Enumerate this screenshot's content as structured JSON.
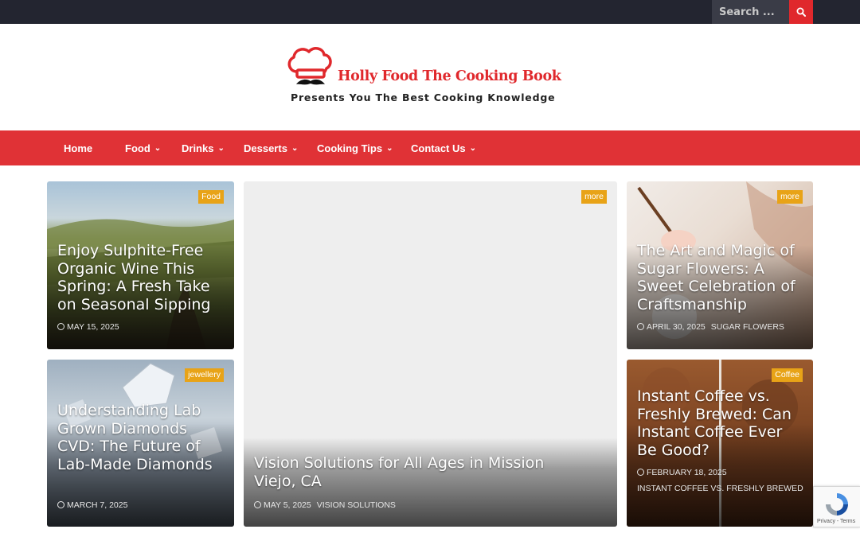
{
  "search": {
    "placeholder": "Search ..."
  },
  "logo": {
    "title": "Holly Food The Cooking Book",
    "tagline": "Presents You The Best Cooking Knowledge"
  },
  "nav": [
    {
      "label": "Home",
      "has_dropdown": false
    },
    {
      "label": "Food",
      "has_dropdown": true
    },
    {
      "label": "Drinks",
      "has_dropdown": true
    },
    {
      "label": "Desserts",
      "has_dropdown": true
    },
    {
      "label": "Cooking Tips",
      "has_dropdown": true
    },
    {
      "label": "Contact Us",
      "has_dropdown": true
    }
  ],
  "cards": [
    {
      "badge": "Food",
      "title": "Enjoy Sulphite-Free Organic Wine This Spring: A Fresh Take on Seasonal Sipping",
      "date": "MAY 15, 2025",
      "category": ""
    },
    {
      "badge": "jewellery",
      "title": "Understanding Lab Grown Diamonds CVD: The Future of Lab-Made Diamonds",
      "date": "MARCH 7, 2025",
      "category": ""
    },
    {
      "badge": "more",
      "title": "Vision Solutions for All Ages in Mission Viejo, CA",
      "date": "MAY 5, 2025",
      "category": "VISION SOLUTIONS"
    },
    {
      "badge": "more",
      "title": "The Art and Magic of Sugar Flowers: A Sweet Celebration of Craftsmanship",
      "date": "APRIL 30, 2025",
      "category": "SUGAR FLOWERS"
    },
    {
      "badge": "Coffee",
      "title": "Instant Coffee vs. Freshly Brewed: Can Instant Coffee Ever Be Good?",
      "date": "FEBRUARY 18, 2025",
      "category": "INSTANT COFFEE VS. FRESHLY BREWED"
    }
  ],
  "recaptcha": {
    "text": "Privacy - Terms"
  },
  "colors": {
    "topbar": "#232530",
    "accent_red": "#e0282c",
    "nav_red": "#e03236",
    "badge_orange": "#e8a317"
  }
}
